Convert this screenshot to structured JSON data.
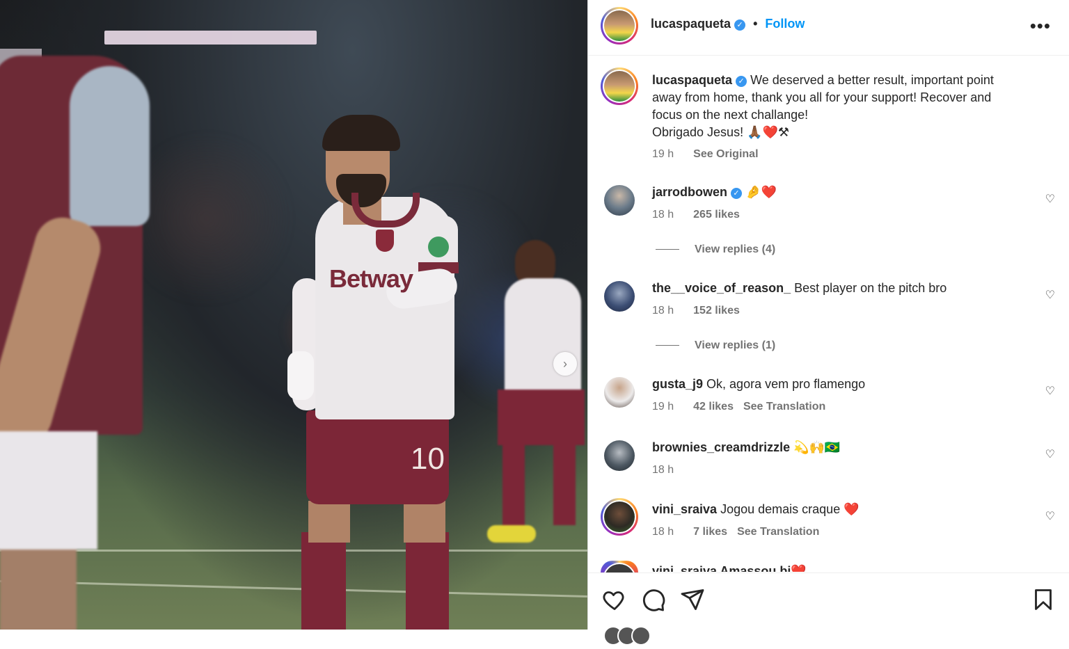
{
  "post": {
    "author": "lucaspaqueta",
    "verified": true,
    "follow_label": "Follow",
    "separator": "•",
    "more_label": "•••",
    "carousel_next": "›"
  },
  "caption": {
    "username": "lucaspaqueta",
    "lines": [
      "We deserved a better result, important point",
      "away from home, thank you all for your support! Recover and",
      "focus on the next challange!",
      "Obrigado Jesus! 🙏🏾❤️⚒"
    ],
    "time": "19 h",
    "see_original": "See Original"
  },
  "comments": [
    {
      "username": "jarrodbowen",
      "verified": true,
      "text": "🤌❤️",
      "time": "18 h",
      "likes": "265 likes",
      "replies": "View replies (4)"
    },
    {
      "username": "the__voice_of_reason_",
      "verified": false,
      "text": "Best player on the pitch bro",
      "time": "18 h",
      "likes": "152 likes",
      "replies": "View replies (1)"
    },
    {
      "username": "gusta_j9",
      "verified": false,
      "text": "Ok, agora vem pro flamengo",
      "time": "19 h",
      "likes": "42 likes",
      "translation": "See Translation"
    },
    {
      "username": "brownies_creamdrizzle",
      "verified": false,
      "text": "💫🙌🇧🇷",
      "time": "18 h"
    },
    {
      "username": "vini_sraiva",
      "verified": false,
      "text": "Jogou demais craque ❤️",
      "time": "18 h",
      "likes": "7 likes",
      "translation": "See Translation"
    }
  ],
  "cutoff_comment": "vini_sraiva Amassou bi❤️",
  "photo": {
    "sponsor": "Betway",
    "shirt_number": "10"
  },
  "colors": {
    "accent": "#0095f6",
    "verified": "#3897f0",
    "text": "#262626",
    "muted": "#737373"
  },
  "icons": {
    "like": "heart-icon",
    "comment": "comment-icon",
    "share": "paper-plane-icon",
    "save": "bookmark-icon"
  }
}
